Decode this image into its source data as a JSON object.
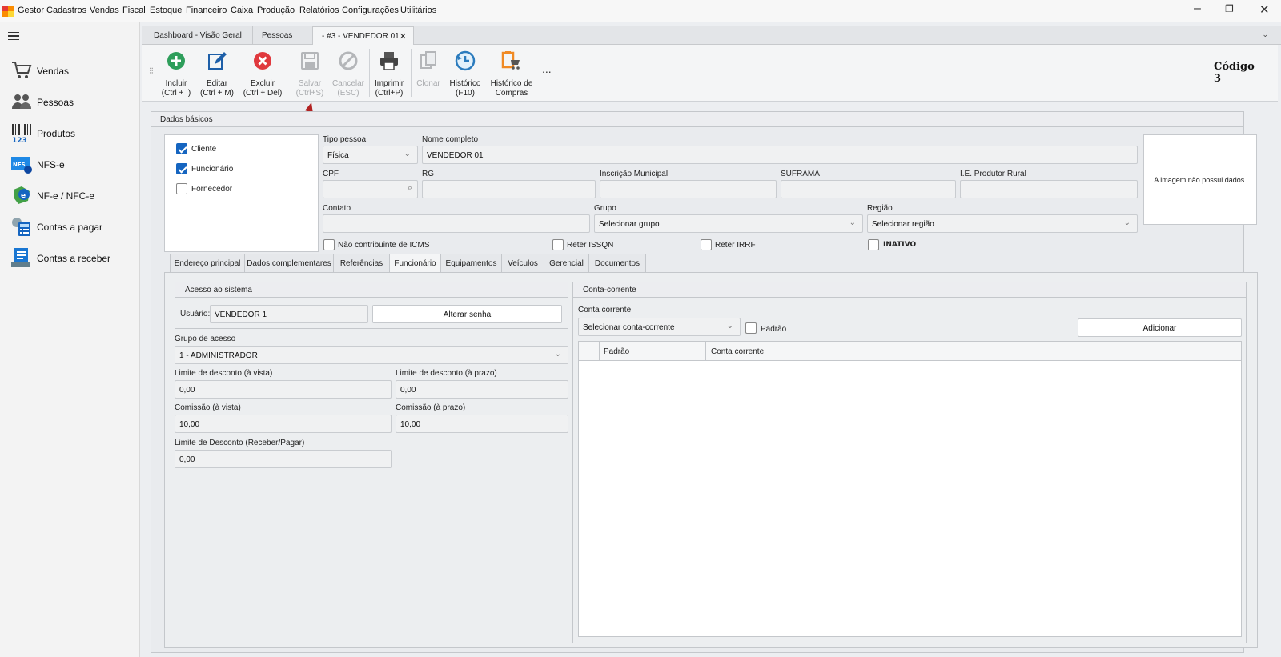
{
  "menubar": {
    "items": [
      "Gestor",
      "Cadastros",
      "Vendas",
      "Fiscal",
      "Estoque",
      "Financeiro",
      "Caixa",
      "Produção",
      "Relatórios",
      "Configurações",
      "Utilitários"
    ]
  },
  "sidebar": {
    "items": [
      {
        "label": "Vendas",
        "icon": "cart-icon"
      },
      {
        "label": "Pessoas",
        "icon": "people-icon"
      },
      {
        "label": "Produtos",
        "icon": "barcode-icon"
      },
      {
        "label": "NFS-e",
        "icon": "nfse-icon"
      },
      {
        "label": "NF-e / NFC-e",
        "icon": "nfe-icon"
      },
      {
        "label": "Contas a pagar",
        "icon": "calculator-icon"
      },
      {
        "label": "Contas a receber",
        "icon": "receipt-icon"
      }
    ]
  },
  "doc_tabs": [
    {
      "label": "Dashboard - Visão Geral"
    },
    {
      "label": "Pessoas"
    },
    {
      "label": "- #3 - VENDEDOR 01",
      "active": true
    }
  ],
  "toolbar": {
    "incluir": [
      "Incluir",
      "(Ctrl + I)"
    ],
    "editar": [
      "Editar",
      "(Ctrl + M)"
    ],
    "excluir": [
      "Excluir",
      "(Ctrl + Del)"
    ],
    "salvar": [
      "Salvar",
      "(Ctrl+S)"
    ],
    "cancelar": [
      "Cancelar",
      "(ESC)"
    ],
    "imprimir": [
      "Imprimir",
      "(Ctrl+P)"
    ],
    "clonar": [
      "Clonar",
      ""
    ],
    "historico": [
      "Histórico",
      "(F10)"
    ],
    "historico_compras": [
      "Histórico de",
      "Compras"
    ],
    "more": "...",
    "codigo_label": "Código",
    "codigo_value": "3"
  },
  "dados_basicos": {
    "title": "Dados básicos",
    "tipos": [
      {
        "label": "Cliente",
        "checked": true
      },
      {
        "label": "Funcionário",
        "checked": true
      },
      {
        "label": "Fornecedor",
        "checked": false
      }
    ],
    "tipo_pessoa_label": "Tipo pessoa",
    "tipo_pessoa_value": "Física",
    "nome_label": "Nome completo",
    "nome_value": "VENDEDOR 01",
    "cpf_label": "CPF",
    "rg_label": "RG",
    "im_label": "Inscrição Municipal",
    "suframa_label": "SUFRAMA",
    "ie_label": "I.E. Produtor Rural",
    "contato_label": "Contato",
    "grupo_label": "Grupo",
    "grupo_value": "Selecionar grupo",
    "regiao_label": "Região",
    "regiao_value": "Selecionar região",
    "icms_label": "Não contribuinte de ICMS",
    "issqn_label": "Reter ISSQN",
    "irrf_label": "Reter IRRF",
    "inativo_label": "INATIVO",
    "image_text": "A imagem não possui dados."
  },
  "sub_tabs": [
    "Endereço principal",
    "Dados complementares",
    "Referências",
    "Funcionário",
    "Equipamentos",
    "Veículos",
    "Gerencial",
    "Documentos"
  ],
  "funcionario": {
    "acesso_title": "Acesso ao sistema",
    "usuario_label": "Usuário:",
    "usuario_value": "VENDEDOR 1",
    "alterar_senha": "Alterar senha",
    "grupo_acesso_label": "Grupo de acesso",
    "grupo_acesso_value": "1 - ADMINISTRADOR",
    "lim_vista_label": "Limite de desconto (à vista)",
    "lim_vista_value": "0,00",
    "lim_prazo_label": "Limite de desconto (à prazo)",
    "lim_prazo_value": "0,00",
    "com_vista_label": "Comissão (à vista)",
    "com_vista_value": "10,00",
    "com_prazo_label": "Comissão (à prazo)",
    "com_prazo_value": "10,00",
    "lim_rp_label": "Limite de Desconto (Receber/Pagar)",
    "lim_rp_value": "0,00"
  },
  "conta_corrente": {
    "title": "Conta-corrente",
    "label": "Conta corrente",
    "select_value": "Selecionar conta-corrente",
    "padrao_label": "Padrão",
    "adicionar": "Adicionar",
    "columns": [
      "Padrão",
      "Conta corrente"
    ]
  },
  "colors": {
    "accent": "#1565c0",
    "arrow": "#b22222"
  }
}
